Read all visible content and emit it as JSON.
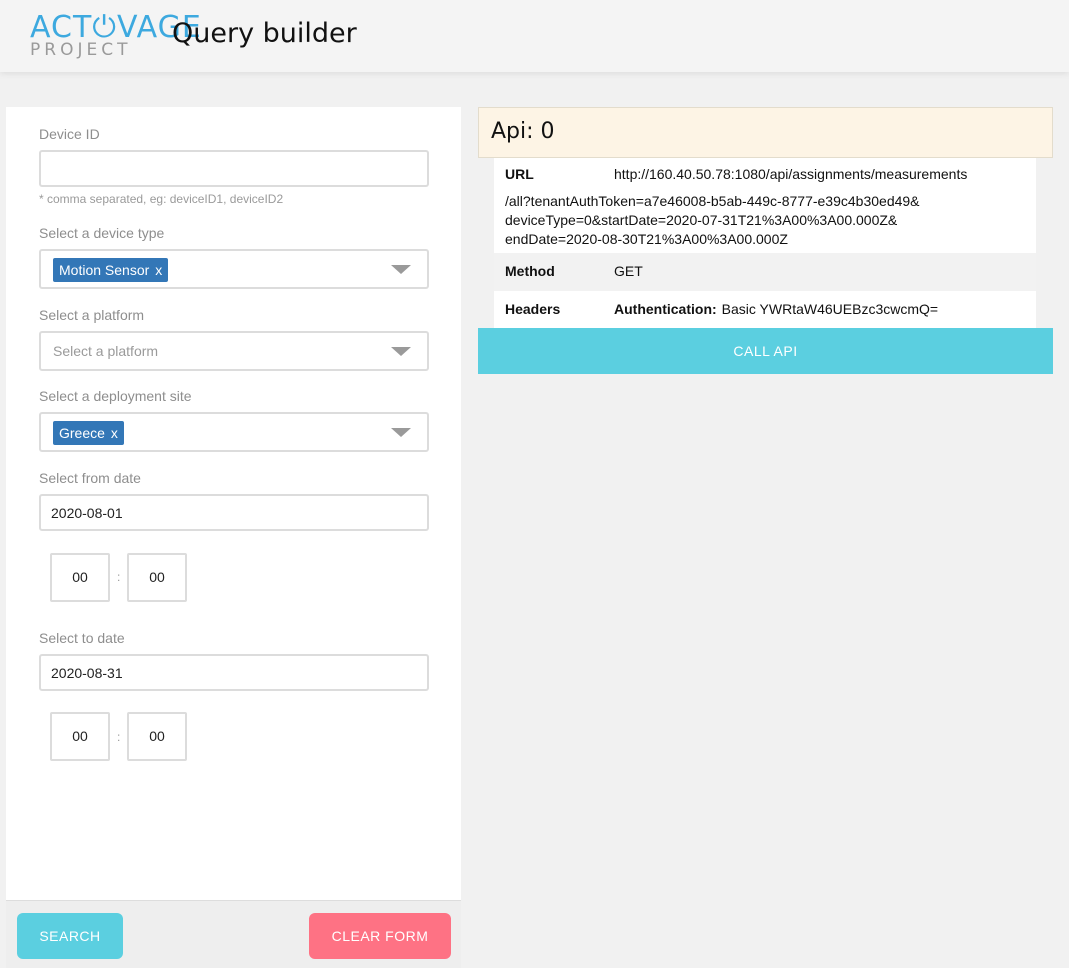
{
  "header": {
    "logo_main": "ACT⏻VAGE",
    "logo_sub": "PROJECT",
    "title": "Query builder"
  },
  "form": {
    "device_id": {
      "label": "Device ID",
      "value": "",
      "hint": "* comma separated, eg: deviceID1, deviceID2"
    },
    "device_type": {
      "label": "Select a device type",
      "selected_tags": [
        "Motion Sensor"
      ]
    },
    "platform": {
      "label": "Select a platform",
      "placeholder": "Select a platform"
    },
    "deployment_site": {
      "label": "Select a deployment site",
      "selected_tags": [
        "Greece"
      ]
    },
    "tag_remove": "x",
    "from_date": {
      "label": "Select from date",
      "value": "2020-08-01",
      "hour": "00",
      "minute": "00"
    },
    "to_date": {
      "label": "Select to date",
      "value": "2020-08-31",
      "hour": "00",
      "minute": "00"
    },
    "time_separator": ":",
    "search_label": "SEARCH",
    "clear_label": "CLEAR FORM"
  },
  "api": {
    "title": "Api: 0",
    "url_key": "URL",
    "url_lines": [
      "http://160.40.50.78:1080/api/assignments/measurements",
      "/all?tenantAuthToken=a7e46008-b5ab-449c-8777-e39c4b30ed49&",
      "deviceType=0&startDate=2020-07-31T21%3A00%3A00.000Z&",
      "endDate=2020-08-30T21%3A00%3A00.000Z"
    ],
    "method_key": "Method",
    "method_value": "GET",
    "headers_key": "Headers",
    "header_name": "Authentication:",
    "header_value": "Basic YWRtaW46UEBzc3cwcmQ=",
    "call_label": "CALL API"
  },
  "colors": {
    "accent_blue": "#5bcfe0",
    "tag_blue": "#3377b7",
    "clear_red": "#fe7284",
    "api_head_bg": "#fdf4e5"
  }
}
